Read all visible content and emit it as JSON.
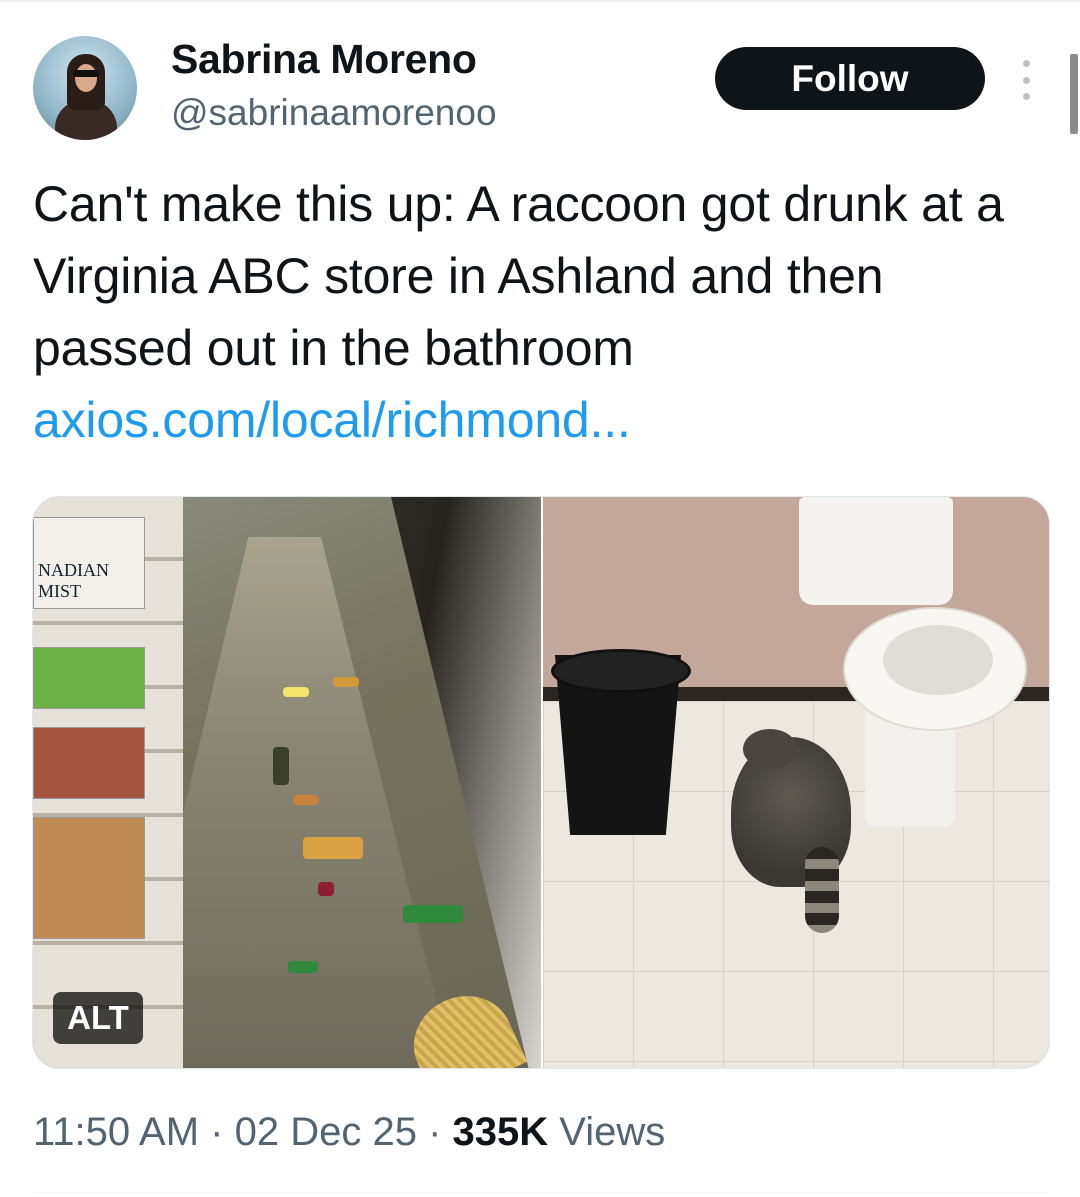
{
  "user": {
    "display_name": "Sabrina Moreno",
    "handle": "@sabrinaamorenoo"
  },
  "actions": {
    "follow_label": "Follow",
    "more_icon": "more-vertical-icon"
  },
  "tweet": {
    "text": "Can't make this up: A raccoon got drunk at a Virginia ABC store in Ashland and then passed out in the bathroom",
    "link": "axios.com/local/richmond..."
  },
  "media": {
    "alt_badge": "ALT",
    "shelf_box_text": "NADIAN MIST"
  },
  "meta": {
    "time": "11:50 AM",
    "sep1": "·",
    "date": "02 Dec 25",
    "sep2": "·",
    "views_count": "335K",
    "views_label": "Views"
  },
  "colors": {
    "link": "#1d9bf0",
    "secondary_text": "#536471",
    "follow_bg": "#0f1419"
  }
}
